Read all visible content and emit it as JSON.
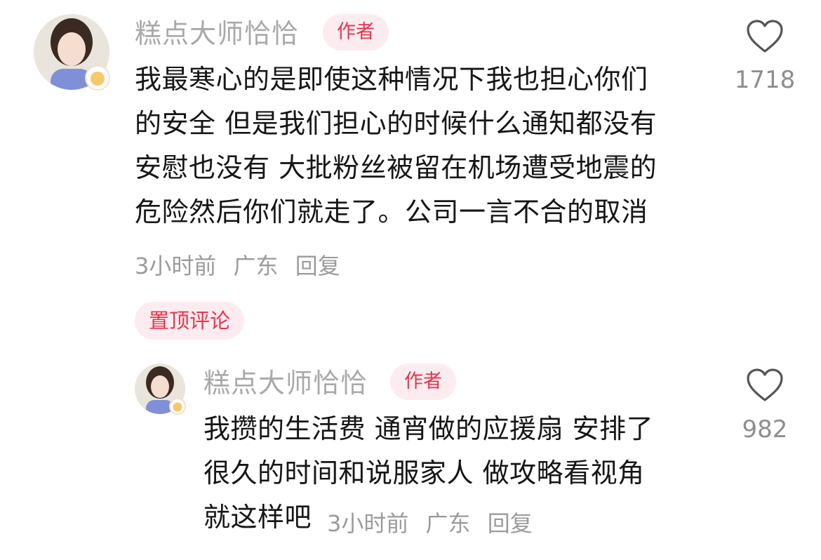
{
  "main_comment": {
    "username": "糕点大师恰恰",
    "badge": "作者",
    "text": "我最寒心的是即使这种情况下我也担心你们\n的安全 但是我们担心的时候什么通知都没有\n安慰也没有 大批粉丝被留在机场遭受地震的\n危险然后你们就走了。公司一言不合的取消",
    "time": "3小时前",
    "location": "广东",
    "reply_label": "回复",
    "like_count": "1718",
    "like_icon": "heart-outline-icon"
  },
  "pinned_label": "置顶评论",
  "reply_comment": {
    "username": "糕点大师恰恰",
    "badge": "作者",
    "text": "我攒的生活费 通宵做的应援扇 安排了\n很久的时间和说服家人 做攻略看视角\n就这样吧",
    "time": "3小时前",
    "location": "广东",
    "reply_label": "回复",
    "like_count": "982",
    "like_icon": "heart-outline-icon"
  },
  "colors": {
    "badge_text": "#e8344e",
    "badge_bg": "#fdecef",
    "username": "#a9a9a9",
    "meta": "#9b9b9b",
    "body_text": "#161616"
  }
}
